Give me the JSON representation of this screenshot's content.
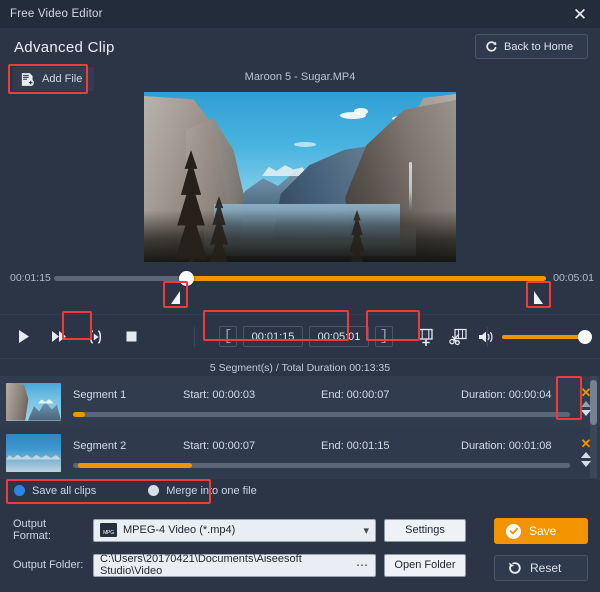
{
  "window": {
    "title": "Free Video Editor",
    "close_icon": "close-icon"
  },
  "header": {
    "page_title": "Advanced Clip",
    "back_home_label": "Back to Home",
    "back_home_icon": "redo-arrow-icon"
  },
  "file_bar": {
    "add_file_label": "Add File",
    "add_file_icon": "file-plus-icon",
    "current_file": "Maroon 5 - Sugar.MP4"
  },
  "timeline": {
    "current_time": "00:01:15",
    "total_time": "00:05:01",
    "playhead_percent": 27,
    "trim_in_icon": "trim-in-handle-icon",
    "trim_out_icon": "trim-out-handle-icon"
  },
  "controls": {
    "play_icon": "play-icon",
    "fast_forward_icon": "fast-forward-icon",
    "set_clip_icon": "set-clip-icon",
    "stop_icon": "stop-icon",
    "bracket_open": "[",
    "bracket_close": "]",
    "clip_start": "00:01:15",
    "clip_end": "00:05:01",
    "add_segment_icon": "add-clip-icon",
    "split_icon": "scissors-split-icon",
    "volume_icon": "volume-icon",
    "volume_percent": 100
  },
  "segments_header": "5 Segment(s) / Total Duration 00:13:35",
  "segments_columns": {
    "start_label": "Start:",
    "end_label": "End:",
    "duration_label": "Duration:"
  },
  "segments": [
    {
      "name": "Segment 1",
      "start": "Start:  00:00:03",
      "end": "End:  00:00:07",
      "duration": "Duration:  00:00:04",
      "bar_offset_percent": 0,
      "bar_width_percent": 2,
      "delete_icon": "delete-x-icon",
      "move_up_icon": "move-up-icon",
      "move_down_icon": "move-down-icon"
    },
    {
      "name": "Segment 2",
      "start": "Start:  00:00:07",
      "end": "End:  00:01:15",
      "duration": "Duration:  00:01:08",
      "bar_offset_percent": 1,
      "bar_width_percent": 23,
      "delete_icon": "delete-x-icon",
      "move_up_icon": "move-up-icon",
      "move_down_icon": "move-down-icon"
    }
  ],
  "save_mode": {
    "option_all_label": "Save all clips",
    "option_merge_label": "Merge into one file",
    "selected": "all"
  },
  "output": {
    "format_label": "Output Format:",
    "format_value": "MPEG-4 Video (*.mp4)",
    "format_badge": "MPG",
    "settings_label": "Settings",
    "folder_label": "Output Folder:",
    "folder_value": "C:\\Users\\20170421\\Documents\\Aiseesoft Studio\\Video",
    "browse_icon": "ellipsis-icon",
    "open_folder_label": "Open Folder",
    "save_label": "Save",
    "save_icon": "check-circle-icon",
    "reset_label": "Reset",
    "reset_icon": "reset-arrow-icon"
  },
  "colors": {
    "accent_orange": "#f29400",
    "highlight_red": "#ef3b3b",
    "radio_blue": "#2e86e0",
    "panel_bg": "#2b3546",
    "titlebar_bg": "#232c3b"
  }
}
